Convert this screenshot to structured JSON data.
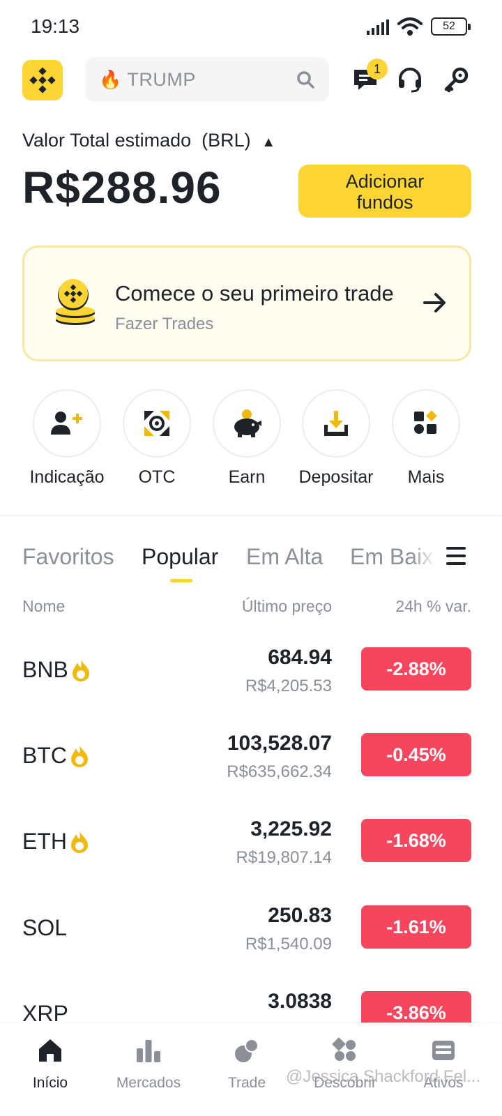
{
  "status_bar": {
    "time": "19:13",
    "battery": "52"
  },
  "header": {
    "search_text": "TRUMP",
    "notification_count": "1",
    "icons": [
      "binance-logo-icon",
      "fire-icon",
      "search-icon",
      "chat-icon",
      "headset-icon",
      "key-icon"
    ]
  },
  "balance": {
    "label": "Valor Total estimado",
    "currency": "(BRL)",
    "value": "R$288.96",
    "add_funds_line1": "Adicionar",
    "add_funds_line2": "fundos"
  },
  "promo": {
    "title": "Comece o seu primeiro trade",
    "subtitle": "Fazer Trades"
  },
  "actions": [
    {
      "label": "Indicação",
      "icon": "add-user-icon"
    },
    {
      "label": "OTC",
      "icon": "otc-icon"
    },
    {
      "label": "Earn",
      "icon": "piggy-bank-icon"
    },
    {
      "label": "Depositar",
      "icon": "deposit-icon"
    },
    {
      "label": "Mais",
      "icon": "more-grid-icon"
    }
  ],
  "tabs": [
    "Favoritos",
    "Popular",
    "Em Alta",
    "Em Baix"
  ],
  "columns": {
    "name": "Nome",
    "last_price": "Último preço",
    "change": "24h % var."
  },
  "markets": [
    {
      "symbol": "BNB",
      "hot": true,
      "price": "684.94",
      "brl": "R$4,205.53",
      "change": "-2.88%"
    },
    {
      "symbol": "BTC",
      "hot": true,
      "price": "103,528.07",
      "brl": "R$635,662.34",
      "change": "-0.45%"
    },
    {
      "symbol": "ETH",
      "hot": true,
      "price": "3,225.92",
      "brl": "R$19,807.14",
      "change": "-1.68%"
    },
    {
      "symbol": "SOL",
      "hot": false,
      "price": "250.83",
      "brl": "R$1,540.09",
      "change": "-1.61%"
    },
    {
      "symbol": "XRP",
      "hot": false,
      "price": "3.0838",
      "brl": "",
      "change": "-3.86%"
    }
  ],
  "bottom_nav": [
    {
      "label": "Início",
      "icon": "home-icon"
    },
    {
      "label": "Mercados",
      "icon": "markets-icon"
    },
    {
      "label": "Trade",
      "icon": "trade-icon"
    },
    {
      "label": "Descobrir",
      "icon": "discover-icon"
    },
    {
      "label": "Ativos",
      "icon": "wallet-icon"
    }
  ],
  "watermark": "@Jessica Shackford Fel..."
}
